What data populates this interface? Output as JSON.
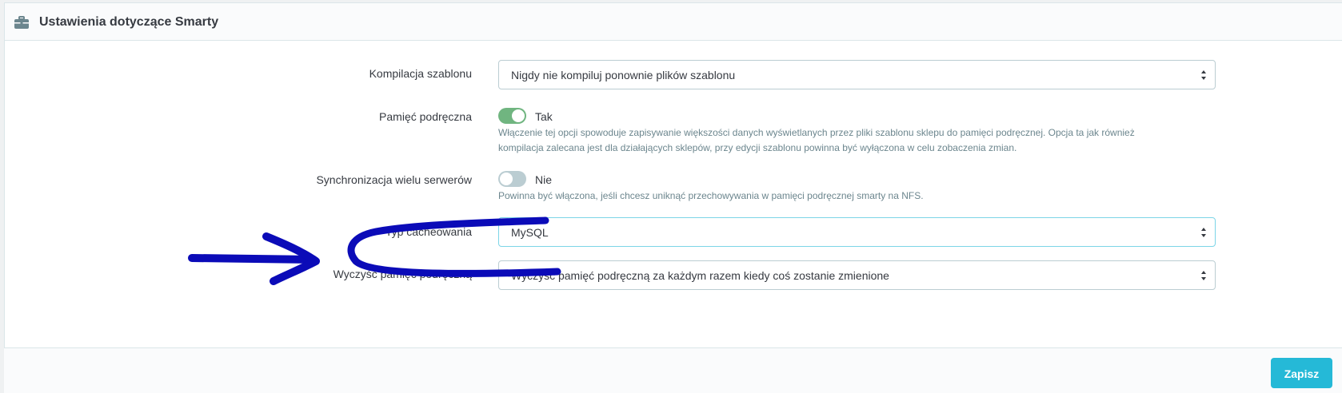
{
  "panel": {
    "title": "Ustawienia dotyczące Smarty",
    "icon": "briefcase-icon"
  },
  "fields": {
    "compilation": {
      "label": "Kompilacja szablonu",
      "value": "Nigdy nie kompiluj ponownie plików szablonu"
    },
    "cache": {
      "label": "Pamięć podręczna",
      "state": "Tak",
      "enabled": true,
      "help": "Włączenie tej opcji spowoduje zapisywanie większości danych wyświetlanych przez pliki szablonu sklepu do pamięci podręcznej. Opcja ta jak również kompilacja zalecana jest dla działających sklepów, przy edycji szablonu powinna być wyłączona w celu zobaczenia zmian."
    },
    "multi_server": {
      "label": "Synchronizacja wielu serwerów",
      "state": "Nie",
      "enabled": false,
      "help": "Powinna być włączona, jeśli chcesz uniknąć przechowywania w pamięci podręcznej smarty na NFS."
    },
    "cache_type": {
      "label": "Typ cacheowania",
      "value": "MySQL"
    },
    "clear_cache": {
      "label": "Wyczyść pamięć podręczną",
      "value": "Wyczyść pamięć podręczną za każdym razem kiedy coś zostanie zmienione"
    }
  },
  "footer": {
    "save_label": "Zapisz"
  },
  "colors": {
    "accent": "#25b9d7",
    "toggle_on": "#70b580",
    "toggle_off": "#bbcdd2",
    "annotation_ink": "#0b0bb8"
  }
}
